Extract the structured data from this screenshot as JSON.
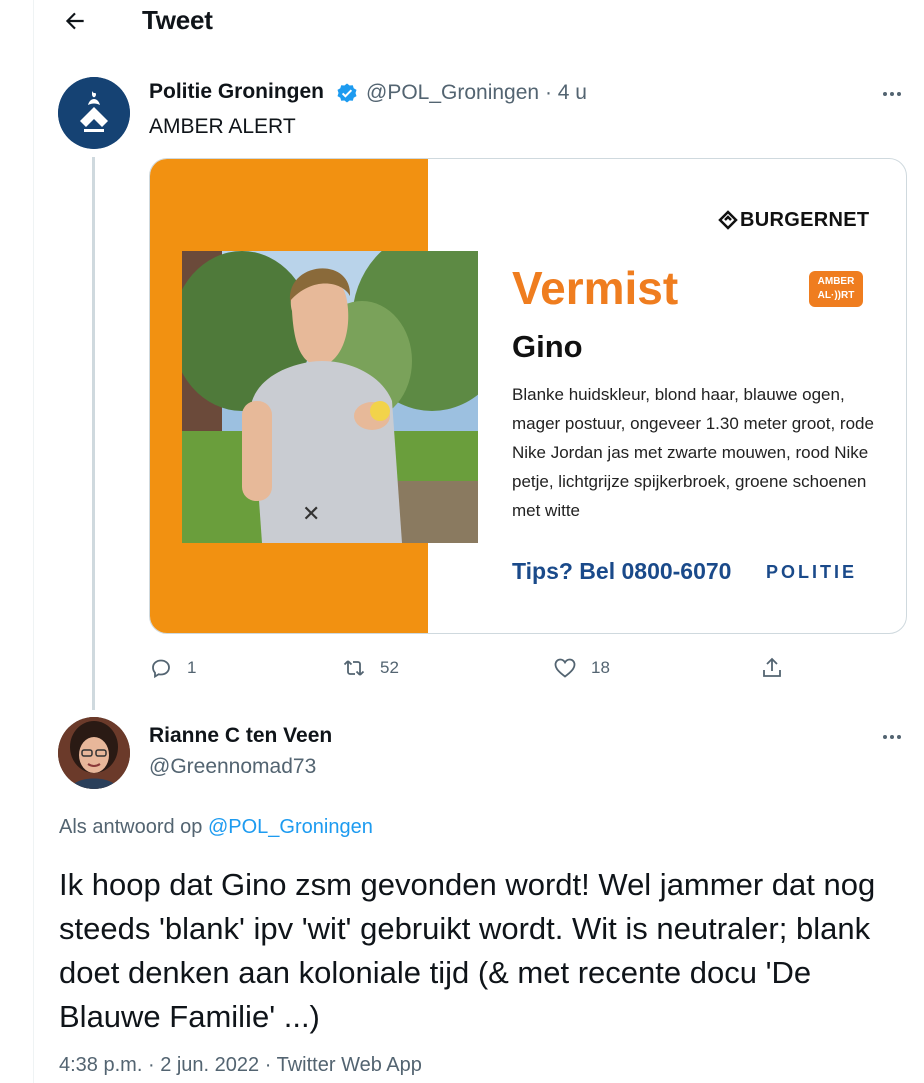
{
  "header": {
    "title": "Tweet"
  },
  "tweet": {
    "author": {
      "name": "Politie Groningen",
      "handle": "@POL_Groningen",
      "time": "4 u",
      "separator": "·"
    },
    "text": "AMBER ALERT",
    "card": {
      "brand": "BURGERNET",
      "headline": "Vermist",
      "badge_line1": "AMBER",
      "badge_line2": "AL·))RT",
      "name": "Gino",
      "description": "Blanke huidskleur, blond haar, blauwe ogen, mager postuur, ongeveer 1.30 meter groot, rode Nike Jordan jas met zwarte mouwen, rood Nike petje, lichtgrijze spijkerbroek, groene schoenen met witte",
      "tips": "Tips? Bel 0800-6070",
      "police_logo": "POLITIE"
    },
    "stats": {
      "replies": "1",
      "retweets": "52",
      "likes": "18"
    }
  },
  "reply": {
    "author": {
      "name": "Rianne C ten Veen",
      "handle": "@Greennomad73"
    },
    "reply_prefix": "Als antwoord op",
    "reply_to": "@POL_Groningen",
    "text": "Ik hoop dat Gino zsm gevonden wordt! Wel jammer dat nog steeds 'blank' ipv 'wit' gebruikt wordt. Wit is neutraler; blank doet denken aan koloniale tijd (& met recente docu 'De Blauwe Familie' ...)",
    "meta": {
      "time": "4:38 p.m.",
      "date": "2 jun. 2022",
      "app": "Twitter Web App",
      "separator": "·"
    }
  },
  "colors": {
    "accent": "#1d9bf0",
    "orange": "#f29111",
    "politie_blue": "#154273",
    "muted": "#536471"
  },
  "icons": [
    "back-arrow-icon",
    "verified-icon",
    "more-icon",
    "reply-icon",
    "retweet-icon",
    "like-icon",
    "share-icon",
    "politie-logo-icon"
  ]
}
